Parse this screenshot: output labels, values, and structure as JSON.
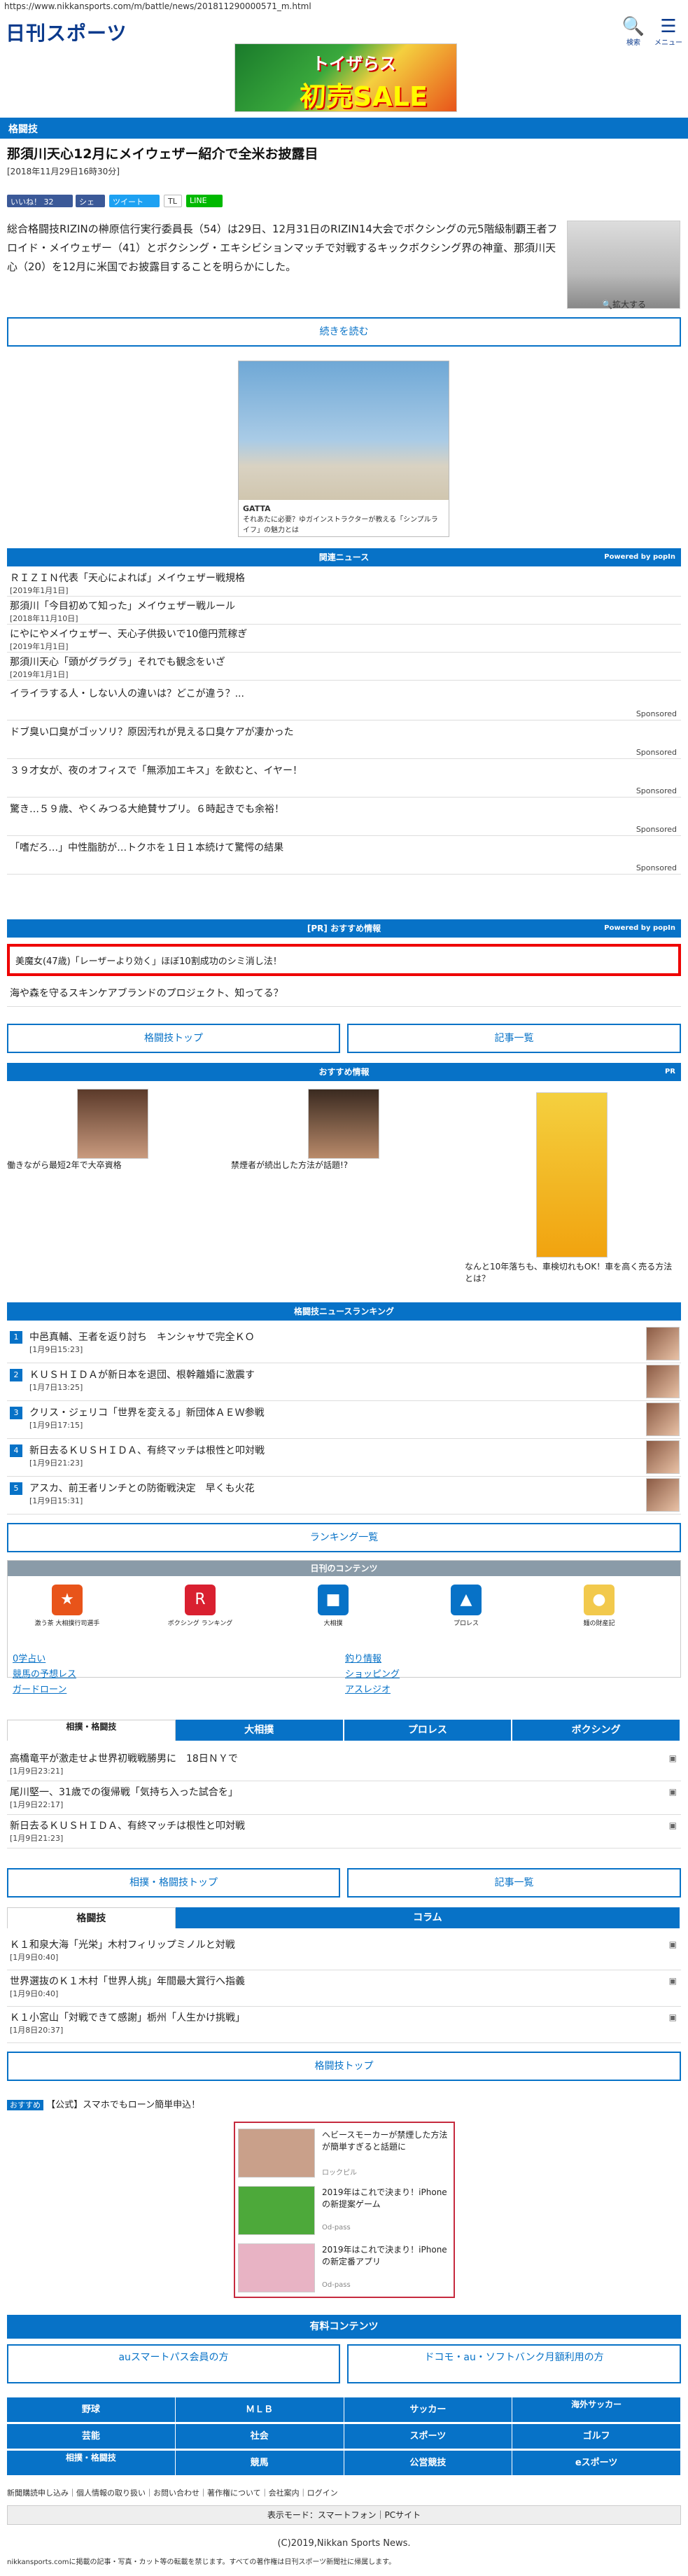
{
  "browser": {
    "url": "https://www.nikkansports.com/m/battle/news/201811290000571_m.html"
  },
  "header": {
    "logo": "日刊スポーツ",
    "search_label": "検索",
    "menu_label": "メニュー"
  },
  "banner": {
    "line1": "トイザらス",
    "line2": "初売SALE"
  },
  "category": "格闘技",
  "article": {
    "title": "那須川天心12月にメイウェザー紹介で全米お披露目",
    "date": "[2018年11月29日16時30分]",
    "share": {
      "like": "いいね！ 32",
      "share": "シェア",
      "tweet": "ツイート",
      "tl": "TL",
      "line": "LINE"
    },
    "lead": "総合格闘技RIZINの榊原信行実行委員長（54）は29日、12月31日のRIZIN14大会でボクシングの元5階級制覇王者フロイド・メイウェザー（41）とボクシング・エキシビションマッチで対戦するキックボクシング界の神童、那須川天心（20）を12月に米国でお披露目することを明らかにした。",
    "enlarge": "拡大する",
    "read_more": "続きを読む"
  },
  "ad": {
    "caption": "それあたに必要？ゆガインストラクターが教える「シンプルライフ」の魅力とは",
    "brand": "GATTA"
  },
  "related": {
    "title": "関連ニュース",
    "powered": "Powered by popIn",
    "items": [
      {
        "text": "ＲＩＺＩＮ代表「天心によれば」メイウェザー戦規格",
        "date": "[2019年1月1日]"
      },
      {
        "text": "那須川「今目初めて知った」メイウェザー戦ルール",
        "date": "[2018年11月10日]"
      },
      {
        "text": "にやにやメイウェザー、天心子供扱いで10億円荒稼ぎ",
        "date": "[2019年1月1日]"
      },
      {
        "text": "那須川天心「頭がグラグラ」それでも観念をいざ",
        "date": "[2019年1月1日]"
      }
    ],
    "sponsored": [
      "イライラする人・しない人の違いは？どこが違う？...",
      "ドブ臭い口臭がゴッソリ？原因汚れが見える口臭ケアが凄かった",
      "３９才女が、夜のオフィスで「無添加エキス」を飲むと、イヤー！",
      "驚き…５９歳、やくみつる大絶賛サプリ。６時起きでも余裕！",
      "「嗜だろ…」中性脂肪が…トクホを１日１本続けて驚愕の結果"
    ],
    "sponsored_label": "Sponsored"
  },
  "pr": {
    "title": "[PR] おすすめ情報",
    "powered": "Powered by popIn",
    "featured": "美魔女(47歳)「レーザーより効く」ほぼ10割成功のシミ消し法！",
    "item2": "海や森を守るスキンケアブランドのプロジェクト、知ってる？"
  },
  "buttons": {
    "top": "格闘技トップ",
    "list": "記事一覧",
    "ranking": "ランキング一覧",
    "sumo_top": "相撲・格闘技トップ",
    "list2": "記事一覧",
    "top2": "格闘技トップ"
  },
  "recommend": {
    "title": "おすすめ情報",
    "pr": "PR",
    "items": [
      "働きながら最短2年で大卒資格",
      "禁煙者が続出した方法が話題!?",
      "なんと10年落ちも、車検切れもOK！車を高く売る方法とは？"
    ]
  },
  "ranking": {
    "title": "格闘技ニュースランキング",
    "items": [
      {
        "n": "1",
        "text": "中邑真輔、王者を返り討ち　キンシャサで完全ＫＯ",
        "date": "[1月9日15:23]"
      },
      {
        "n": "2",
        "text": "ＫＵＳＨＩＤＡが新日本を退団、根幹離婚に激震す",
        "date": "[1月7日13:25]"
      },
      {
        "n": "3",
        "text": "クリス・ジェリコ「世界を変える」新団体ＡＥＷ参戦",
        "date": "[1月9日17:15]"
      },
      {
        "n": "4",
        "text": "新日去るＫＵＳＨＩＤＡ、有終マッチは根性と叩対戦",
        "date": "[1月9日21:23]"
      },
      {
        "n": "5",
        "text": "アスカ、前王者リンチとの防衛戦決定　早くも火花",
        "date": "[1月9日15:31]"
      }
    ]
  },
  "daily": {
    "title": "日刊のコンテンツ",
    "items": [
      "激う茶 大相撲行司選手",
      "ボクシング ランキング",
      "大相撲",
      "プロレス",
      "麺の財産記"
    ],
    "links": [
      "0学占い",
      "競馬の予想レス",
      "ガードローン",
      "釣り情報",
      "ショッピング",
      "アスレジオ"
    ]
  },
  "tabs1": {
    "items": [
      "相撲・格闘技",
      "大相撲",
      "プロレス",
      "ボクシング"
    ],
    "news": [
      {
        "text": "高橋竜平が激走せよ世界初戦戦勝男に　18日ＮＹで",
        "date": "[1月9日23:21]"
      },
      {
        "text": "尾川堅一、31歳での復帰戦「気持ち入った試合を」",
        "date": "[1月9日22:17]"
      },
      {
        "text": "新日去るＫＵＳＨＩＤＡ、有終マッチは根性と叩対戦",
        "date": "[1月9日21:23]"
      }
    ]
  },
  "tabs2": {
    "items": [
      "格闘技",
      "コラム"
    ],
    "news": [
      {
        "text": "Ｋ１和泉大海「光栄」木村フィリップミノルと対戦",
        "date": "[1月9日0:40]"
      },
      {
        "text": "世界選抜のＫ１木村「世界人挑」年間最大賞行へ指義",
        "date": "[1月9日0:40]"
      },
      {
        "text": "Ｋ１小宮山「対戦できて感謝」栃州「人生かけ挑戦」",
        "date": "[1月8日20:37]"
      }
    ]
  },
  "osusume": {
    "label": "おすすめ",
    "text": "【公式】スマホでもローン簡単申込！"
  },
  "ad_links": [
    {
      "text": "ヘビースモーカーが禁煙した方法が簡単すぎると話題に",
      "source": "ロックピル"
    },
    {
      "text": "2019年はこれで決まり！iPhoneの新提案ゲーム",
      "source": "Od-pass"
    },
    {
      "text": "2019年はこれで決まり！iPhoneの新定番アプリ",
      "source": "Od-pass"
    }
  ],
  "paid": {
    "title": "有料コンテンツ",
    "items": [
      "auスマートパス会員の方",
      "ドコモ・au・ソフトバンク月額利用の方"
    ]
  },
  "nav": {
    "items": [
      "野球",
      "ＭＬＢ",
      "サッカー",
      "海外サッカー",
      "芸能",
      "社会",
      "スポーツ",
      "ゴルフ",
      "相撲・格闘技",
      "競馬",
      "公営競技",
      "eスポーツ"
    ]
  },
  "footer": {
    "links": "新聞購読申し込み｜個人情報の取り扱い｜お問い合わせ｜著作権について｜会社案内｜ログイン",
    "mode": "表示モード：スマートフォン｜PCサイト",
    "copyright": "(C)2019,Nikkan Sports News.",
    "notice": "nikkansports.comに掲載の記事・写真・カット等の転載を禁じます。すべての著作権は日刊スポーツ新聞社に帰属します。"
  }
}
